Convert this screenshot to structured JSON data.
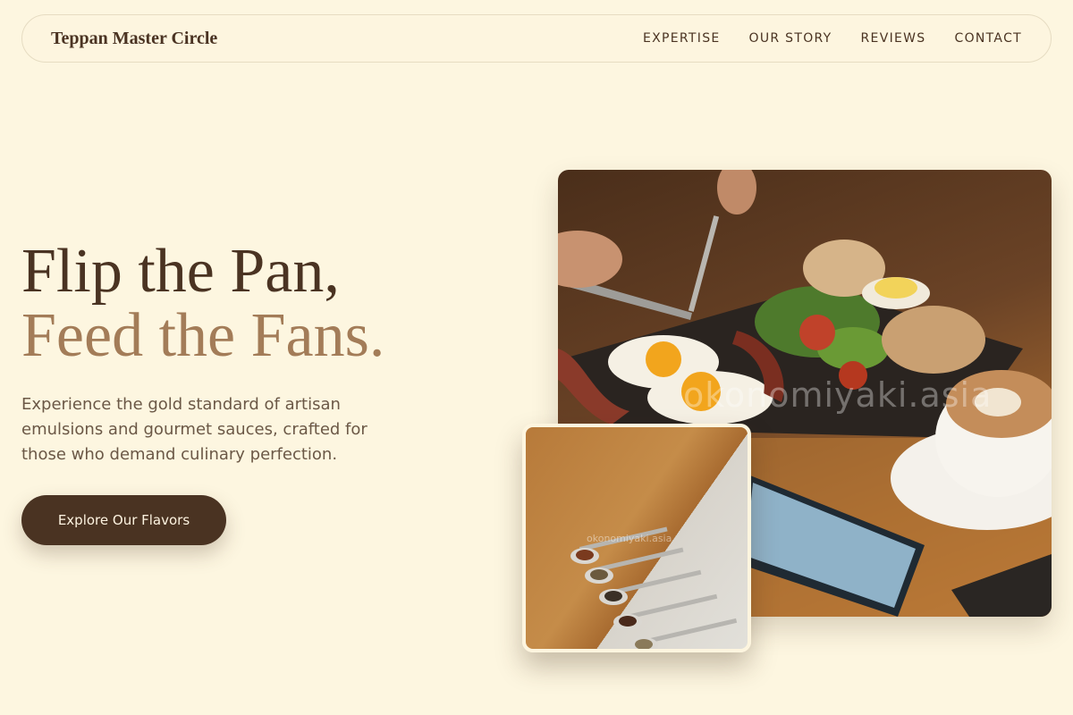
{
  "nav": {
    "brand": "Teppan Master Circle",
    "links": [
      "EXPERTISE",
      "OUR STORY",
      "REVIEWS",
      "CONTACT"
    ]
  },
  "hero": {
    "title_line1": "Flip the Pan,",
    "title_line2": "Feed the Fans.",
    "subtitle": "Experience the gold standard of artisan emulsions and gourmet sauces, crafted for those who demand culinary perfection.",
    "cta_label": "Explore Our Flavors"
  },
  "images": {
    "main_watermark": "okonomiyaki.asia",
    "inset_watermark": "okonomiyaki.asia"
  },
  "colors": {
    "background": "#fdf6e0",
    "primary_brown": "#4a3322",
    "accent_tan": "#a37c58"
  }
}
